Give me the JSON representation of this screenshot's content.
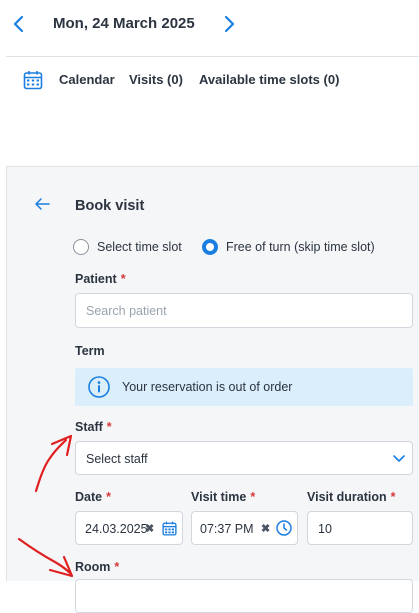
{
  "header": {
    "date": "Mon, 24 March 2025"
  },
  "tabs": {
    "calendar": "Calendar",
    "visits": "Visits (0)",
    "slots": "Available time slots (0)"
  },
  "form": {
    "title": "Book visit",
    "radio_options": [
      "Select time slot",
      "Free of turn (skip time slot)"
    ],
    "selected_radio": 1,
    "patient_label": "Patient",
    "patient_placeholder": "Search patient",
    "term_label": "Term",
    "info_text": "Your reservation is out of order",
    "staff_label": "Staff",
    "staff_value": "Select staff",
    "date_label": "Date",
    "date_value": "24.03.2025",
    "time_label": "Visit time",
    "time_value": "07:37 PM",
    "duration_label": "Visit duration",
    "duration_value": "10",
    "room_label": "Room",
    "required_mark": "*"
  },
  "colors": {
    "accent": "#1a7fe0",
    "required": "#d63a3a",
    "annotation": "#e02020",
    "info_bg": "#dbeefb"
  }
}
